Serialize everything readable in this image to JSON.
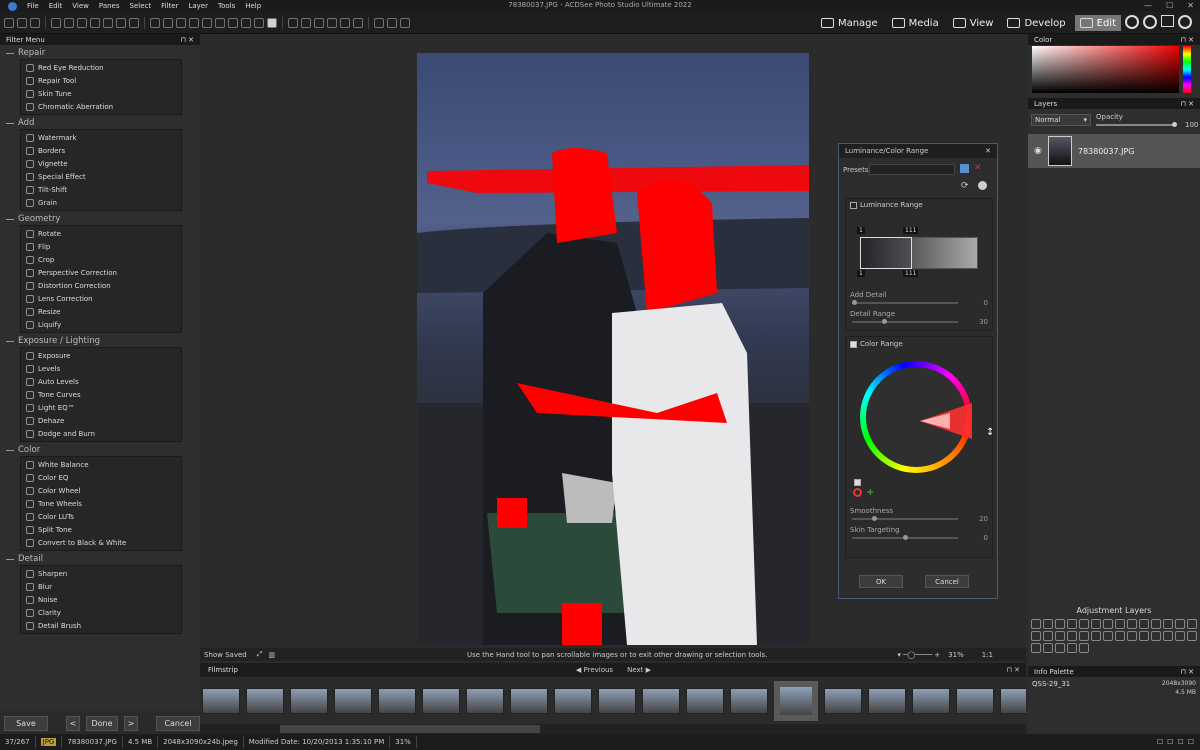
{
  "window": {
    "title": "78380037.JPG - ACDSee Photo Studio Ultimate 2022"
  },
  "menu": [
    "File",
    "Edit",
    "View",
    "Panes",
    "Select",
    "Filter",
    "Layer",
    "Tools",
    "Help"
  ],
  "modes": [
    {
      "label": "Manage"
    },
    {
      "label": "Media"
    },
    {
      "label": "View"
    },
    {
      "label": "Develop"
    },
    {
      "label": "Edit",
      "active": true
    }
  ],
  "filter_menu": {
    "title": "Filter Menu",
    "groups": [
      {
        "name": "Repair",
        "items": [
          "Red Eye Reduction",
          "Repair Tool",
          "Skin Tune",
          "Chromatic Aberration"
        ]
      },
      {
        "name": "Add",
        "items": [
          "Watermark",
          "Borders",
          "Vignette",
          "Special Effect",
          "Tilt-Shift",
          "Grain"
        ]
      },
      {
        "name": "Geometry",
        "items": [
          "Rotate",
          "Flip",
          "Crop",
          "Perspective Correction",
          "Distortion Correction",
          "Lens Correction",
          "Resize",
          "Liquify"
        ]
      },
      {
        "name": "Exposure / Lighting",
        "items": [
          "Exposure",
          "Levels",
          "Auto Levels",
          "Tone Curves",
          "Light EQ™",
          "Dehaze",
          "Dodge and Burn"
        ]
      },
      {
        "name": "Color",
        "items": [
          "White Balance",
          "Color EQ",
          "Color Wheel",
          "Tone Wheels",
          "Color LUTs",
          "Split Tone",
          "Convert to Black & White"
        ]
      },
      {
        "name": "Detail",
        "items": [
          "Sharpen",
          "Blur",
          "Noise",
          "Clarity",
          "Detail Brush"
        ]
      }
    ]
  },
  "left_buttons": {
    "save": "Save",
    "prev": "<",
    "done": "Done",
    "next": ">",
    "cancel": "Cancel"
  },
  "dialog": {
    "title": "Luminance/Color Range",
    "presets_label": "Presets",
    "luminance": {
      "label": "Luminance Range",
      "handle_tl": "1",
      "handle_tr": "111",
      "handle_bl": "1",
      "handle_br": "111",
      "add_detail_label": "Add Detail",
      "add_detail_value": "0",
      "add_detail_level": 0,
      "detail_range_label": "Detail Range",
      "detail_range_value": "30",
      "detail_range_level": 0.3
    },
    "color": {
      "label": "Color Range",
      "smoothness_label": "Smoothness",
      "smoothness_value": "20",
      "smoothness_level": 0.2,
      "skin_label": "Skin Targeting",
      "skin_value": "0",
      "skin_level": 0.5
    },
    "ok": "OK",
    "cancel": "Cancel"
  },
  "status": {
    "show_saved": "Show Saved",
    "hint": "Use the Hand tool to pan scrollable images or to exit other drawing or selection tools.",
    "zoom": "31%",
    "ratio": "1:1"
  },
  "filmstrip": {
    "label": "Filmstrip",
    "previous": "Previous",
    "next": "Next"
  },
  "right": {
    "color_title": "Color",
    "layers_title": "Layers",
    "blend_mode": "Normal",
    "opacity_label": "Opacity",
    "opacity_value": "100",
    "layer_name": "78380037.JPG",
    "adjustment_title": "Adjustment Layers",
    "info_title": "Info Palette",
    "info_name": "QSS-29_31",
    "info_dims": "2048x3090",
    "info_size": "4.5 MB"
  },
  "bottom": {
    "count": "37/267",
    "format": "JPG",
    "file": "78380037.JPG",
    "size": "4.5 MB",
    "dims": "2048x3090x24b.jpeg",
    "modified": "Modified Date: 10/20/2013 1:35:10 PM",
    "zoom": "31%"
  },
  "colors": {
    "accent": "#4a5a7a",
    "highlight": "#ff0000"
  }
}
